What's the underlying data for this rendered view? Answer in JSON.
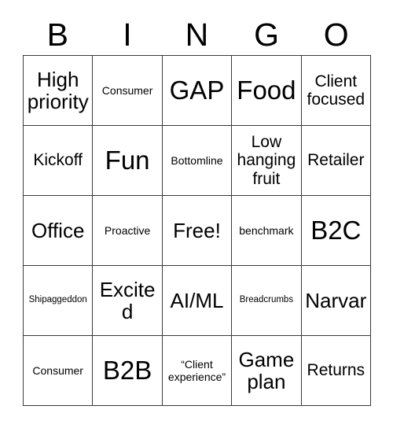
{
  "card": {
    "header_letters": [
      "B",
      "I",
      "N",
      "G",
      "O"
    ],
    "columns": 5,
    "rows": 5,
    "border_color": "#3a3a3a",
    "background_color": "#ffffff",
    "text_color": "#000000",
    "cells": [
      [
        {
          "text": "High priority",
          "size": "l"
        },
        {
          "text": "Consumer",
          "size": "s"
        },
        {
          "text": "GAP",
          "size": "xl"
        },
        {
          "text": "Food",
          "size": "xl"
        },
        {
          "text": "Client focused",
          "size": "m"
        }
      ],
      [
        {
          "text": "Kickoff",
          "size": "m"
        },
        {
          "text": "Fun",
          "size": "xl"
        },
        {
          "text": "Bottomline",
          "size": "s"
        },
        {
          "text": "Low hanging fruit",
          "size": "m"
        },
        {
          "text": "Retailer",
          "size": "m"
        }
      ],
      [
        {
          "text": "Office",
          "size": "l"
        },
        {
          "text": "Proactive",
          "size": "s"
        },
        {
          "text": "Free!",
          "size": "l"
        },
        {
          "text": "benchmark",
          "size": "s"
        },
        {
          "text": "B2C",
          "size": "xl"
        }
      ],
      [
        {
          "text": "Shipaggeddon",
          "size": "xs"
        },
        {
          "text": "Excited",
          "size": "l"
        },
        {
          "text": "AI/ML",
          "size": "l"
        },
        {
          "text": "Breadcrumbs",
          "size": "xs"
        },
        {
          "text": "Narvar",
          "size": "l"
        }
      ],
      [
        {
          "text": "Consumer",
          "size": "s"
        },
        {
          "text": "B2B",
          "size": "xl"
        },
        {
          "text": "“Client experience”",
          "size": "s"
        },
        {
          "text": "Game plan",
          "size": "l"
        },
        {
          "text": "Returns",
          "size": "m"
        }
      ]
    ]
  }
}
